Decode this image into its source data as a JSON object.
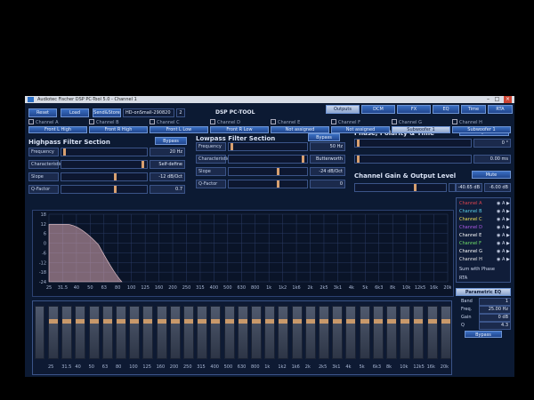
{
  "window": {
    "title": "Audiotec Fischer DSP PC-Tool 5.0 - Channel 1"
  },
  "toolbar": {
    "reset": "Reset",
    "load": "Load",
    "save": "Send&Store",
    "preset_field": "HD-onSmall-290820",
    "preset_num": "2",
    "brand": "DSP PC-TOOL",
    "tabs": [
      "Outputs",
      "DCM",
      "FX",
      "EQ",
      "Time",
      "RTA"
    ]
  },
  "channels": [
    "Channel A",
    "Channel B",
    "Channel C",
    "Channel D",
    "Channel E",
    "Channel F",
    "Channel G",
    "Channel H"
  ],
  "outputs": [
    "Front L High",
    "Front R High",
    "Front L Low",
    "Front R Low",
    "Not assigned",
    "Not assigned",
    "Subwoofer 1",
    "Subwoofer 1"
  ],
  "highpass": {
    "title": "Highpass Filter Section",
    "bypass": "Bypass",
    "rows": [
      {
        "label": "Frequency",
        "value": "20 Hz"
      },
      {
        "label": "Characteristic",
        "value": "Self-define"
      },
      {
        "label": "Slope",
        "value": "-12 dB/Oct"
      },
      {
        "label": "Q-Factor",
        "value": "0.7"
      }
    ]
  },
  "lowpass": {
    "title": "Lowpass Filter Section",
    "bypass": "Bypass",
    "rows": [
      {
        "label": "Frequency",
        "value": "50 Hz"
      },
      {
        "label": "Characteristic",
        "value": "Butterworth"
      },
      {
        "label": "Slope",
        "value": "-24 dB/Oct"
      },
      {
        "label": "Q-Factor",
        "value": "0"
      }
    ]
  },
  "phase": {
    "title": "Phase, Polarity & Time",
    "polarity": "Polarity normal",
    "deg": "0 °",
    "ms": "0.00 ms"
  },
  "gain": {
    "title": "Channel Gain & Output Level",
    "mute": "Mute",
    "value": "-40.65 dB",
    "output": "-6.00 dB"
  },
  "freq_axis": [
    "25",
    "31.5",
    "40",
    "50",
    "63",
    "80",
    "100",
    "125",
    "160",
    "200",
    "250",
    "315",
    "400",
    "500",
    "630",
    "800",
    "1k",
    "1k2",
    "1k6",
    "2k",
    "2k5",
    "3k1",
    "4k",
    "5k",
    "6k3",
    "8k",
    "10k",
    "12k5",
    "16k",
    "20k"
  ],
  "db_axis": [
    "18",
    "12",
    "6",
    "0",
    "-6",
    "-12",
    "-18",
    "-24"
  ],
  "right_panel": {
    "channels": [
      {
        "name": "Channel A",
        "color": "#e0454f"
      },
      {
        "name": "Channel B",
        "color": "#5ad1e8"
      },
      {
        "name": "Channel C",
        "color": "#f1e35a"
      },
      {
        "name": "Channel D",
        "color": "#b05ae8"
      },
      {
        "name": "Channel E",
        "color": "#ffffff"
      },
      {
        "name": "Channel F",
        "color": "#6fe06a"
      },
      {
        "name": "Channel G",
        "color": "#ffffff"
      },
      {
        "name": "Channel H",
        "color": "#e8e8e8"
      }
    ],
    "sum": "Sum with Phase",
    "rta": "RTA"
  },
  "peq": {
    "title": "Parametric EQ",
    "rows": [
      {
        "label": "Band",
        "value": "1"
      },
      {
        "label": "Freq.",
        "value": "25.00 Hz"
      },
      {
        "label": "Gain",
        "value": "0 dB"
      },
      {
        "label": "Q",
        "value": "4.3"
      }
    ],
    "bypass": "Bypass"
  },
  "eq_band_labels": [
    "25",
    "31.5",
    "40",
    "50",
    "63",
    "80",
    "100",
    "125",
    "160",
    "200",
    "250",
    "315",
    "400",
    "500",
    "630",
    "800",
    "1k",
    "1k2",
    "1k6",
    "2k",
    "2k5",
    "3k1",
    "4k",
    "5k",
    "6k3",
    "8k",
    "10k",
    "12k5",
    "16k",
    "20k"
  ]
}
